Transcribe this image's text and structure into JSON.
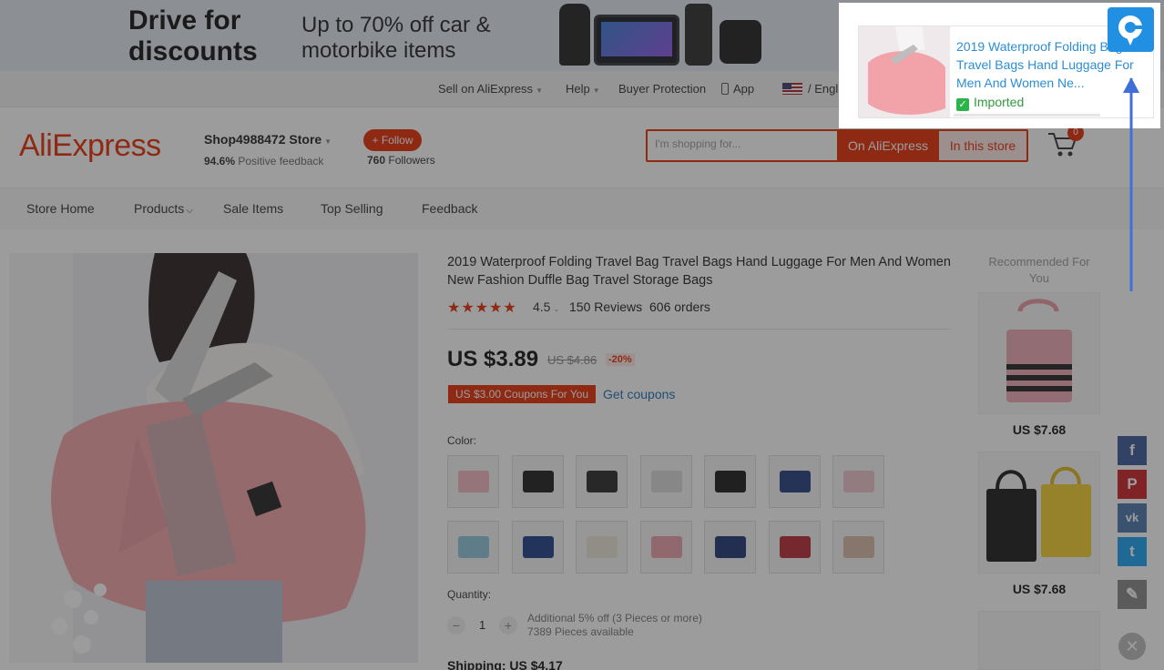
{
  "banner": {
    "headline": "Drive for discounts",
    "subline": "Up to 70% off car & motorbike items"
  },
  "topbar": {
    "items": [
      "Sell on AliExpress",
      "Help",
      "Buyer Protection",
      "App",
      "/ English /"
    ]
  },
  "header": {
    "logo": "AliExpress",
    "store_name": "Shop4988472 Store",
    "feedback_pct": "94.6%",
    "feedback_label": "Positive feedback",
    "follow_label": "+ Follow",
    "followers_count": "760",
    "followers_label": "Followers",
    "search_placeholder": "I'm shopping for...",
    "search_btn_all": "On AliExpress",
    "search_btn_store": "In this store",
    "cart_count": "0"
  },
  "nav": {
    "items": [
      "Store Home",
      "Products",
      "Sale Items",
      "Top Selling",
      "Feedback"
    ]
  },
  "product": {
    "title": "2019 Waterproof Folding Travel Bag Travel Bags Hand Luggage For Men And Women New Fashion Duffle Bag Travel Storage Bags",
    "stars": "★★★★★",
    "rating": "4.5",
    "reviews": "150 Reviews",
    "orders": "606 orders",
    "price": "US $3.89",
    "old_price": "US $4.86",
    "discount": "-20%",
    "coupon": "US $3.00 Coupons For You",
    "get_coupons": "Get coupons",
    "color_label": "Color:",
    "swatch_colors": [
      "#f2b7bf",
      "#1e1e1e",
      "#2a2a2a",
      "#d9d9d9",
      "#1a1a1a",
      "#23407e",
      "#efc5cb",
      "#8ec6dd",
      "#1f3e8a",
      "#eae3d8",
      "#e9a0a8",
      "#1e3773",
      "#b72a33",
      "#d7b9a4"
    ],
    "quantity_label": "Quantity:",
    "quantity_value": "1",
    "quantity_note_1": "Additional 5% off (3 Pieces or more)",
    "quantity_note_2": "7389 Pieces available",
    "shipping": "Shipping: US $4.17"
  },
  "recommended": {
    "title": "Recommended For You",
    "prices": [
      "US $7.68",
      "US $7.68"
    ]
  },
  "share": {
    "labels": [
      "f",
      "P",
      "vk",
      "t",
      "✎"
    ],
    "colors": [
      "#3b5998",
      "#cb2027",
      "#4a76a8",
      "#1da1f2",
      "#888888"
    ]
  },
  "popup": {
    "title": "2019 Waterproof Folding Bag Travel Bags Hand Luggage For Men And Women Ne...",
    "status": "Imported"
  },
  "colors": {
    "accent": "#e62e04",
    "link": "#2b8fd6",
    "extension": "#2190e3"
  }
}
